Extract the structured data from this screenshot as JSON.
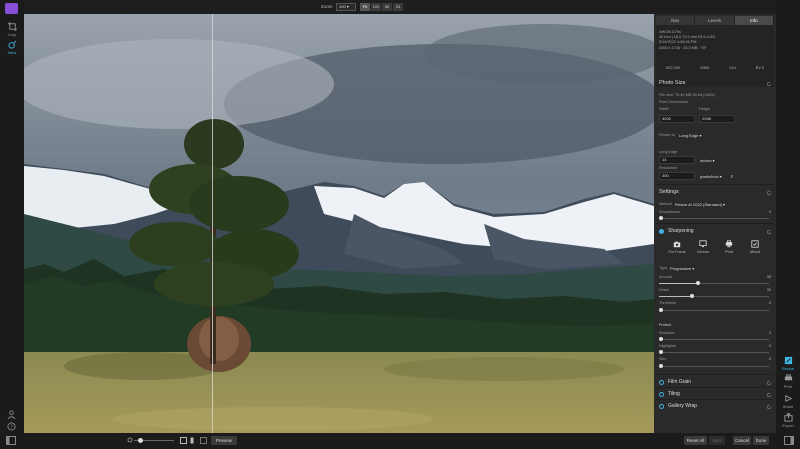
{
  "left_tools": [
    {
      "label": "Crop",
      "icon": "crop-icon"
    },
    {
      "label": "View",
      "icon": "view-icon"
    }
  ],
  "zoom": {
    "label": "Zoom",
    "value": "100",
    "buttons": [
      "Fit",
      "100",
      "50",
      "25"
    ],
    "active": "Fit"
  },
  "panel": {
    "tabs": [
      "Nav",
      "Levels",
      "Info"
    ],
    "active_tab": "Info",
    "info_lines": [
      "NIKON D70s",
      "40 mm | 18.0-70.0 mm f/3.5-4.5G",
      "5/14/2022 4:08:26 PM",
      "2400 x 1748 · 28.3 MB · TIF"
    ],
    "info_stats": [
      "ISO 200",
      "1/500",
      "f/14",
      "EV 0"
    ],
    "photo_size": {
      "title": "Photo Size",
      "file_size": "File size: 76.45 MB 16-bit (146%)",
      "pixel_dim_label": "Pixel Dimensions",
      "width_label": "Width",
      "height_label": "Height",
      "width_value": "4200",
      "height_value": "2946",
      "resize_to_label": "Resize to",
      "resize_to_value": "Long Edge",
      "long_edge_label": "Long Edge",
      "long_edge_value": "14",
      "long_edge_unit": "inches",
      "resolution_label": "Resolution",
      "resolution_value": "300",
      "resolution_unit": "pixels/inch"
    },
    "settings": {
      "title": "Settings",
      "method_label": "Method",
      "method_value": "Resize AI 2022 (Standard)",
      "smoothness_label": "Smoothness",
      "smoothness_value": "0"
    },
    "sharpening": {
      "title": "Sharpening",
      "options": [
        {
          "label": "For Focus",
          "icon": "camera-icon"
        },
        {
          "label": "Screen",
          "icon": "monitor-icon"
        },
        {
          "label": "Print",
          "icon": "printer-icon"
        },
        {
          "label": "Mixed",
          "icon": "checkbox-icon"
        }
      ],
      "type_label": "Type",
      "type_value": "Progressive",
      "amount_label": "Amount",
      "amount_value": "35",
      "amount_level": 0.35,
      "detail_label": "Detail",
      "detail_value": "30",
      "detail_level": 0.3,
      "threshold_label": "Threshold",
      "threshold_value": "0",
      "threshold_level": 0.0
    },
    "protect": {
      "title": "Protect",
      "shadows_label": "Shadows",
      "shadows_value": "0",
      "highlights_label": "Highlights",
      "highlights_value": "0",
      "skin_label": "Skin",
      "skin_value": "0"
    },
    "collapsed": [
      "Film Grain",
      "Tiling",
      "Gallery Wrap"
    ]
  },
  "right_tools": [
    {
      "label": "Resize",
      "icon": "resize-icon"
    },
    {
      "label": "Print",
      "icon": "print-icon"
    },
    {
      "label": "Share",
      "icon": "share-icon"
    },
    {
      "label": "Export",
      "icon": "export-icon"
    }
  ],
  "bottom": {
    "preview_label": "Preview",
    "reset_all_label": "Reset All",
    "sync_label": "Sync",
    "cancel_label": "Cancel",
    "done_label": "Done"
  },
  "colors": {
    "accent": "#3fb5e6",
    "brand": "#8a4fd8"
  }
}
